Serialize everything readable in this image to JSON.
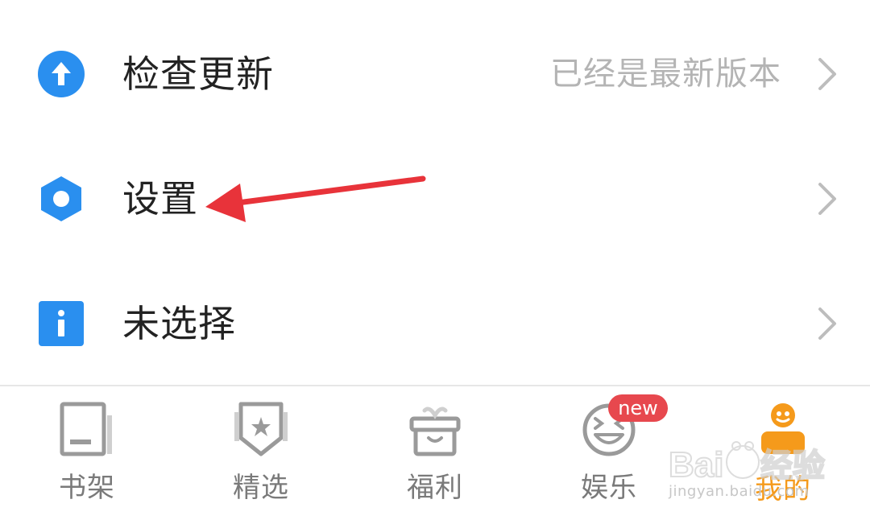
{
  "settings": {
    "items": [
      {
        "label": "检查更新",
        "value": "已经是最新版本",
        "icon": "upload-arrow-icon",
        "icon_color": "#2a8fef"
      },
      {
        "label": "设置",
        "value": "",
        "icon": "gear-hexagon-icon",
        "icon_color": "#2a8fef"
      },
      {
        "label": "未选择",
        "value": "",
        "icon": "info-icon",
        "icon_color": "#2a8fef"
      }
    ]
  },
  "annotation": {
    "arrow_color": "#e8333a"
  },
  "tabbar": {
    "tabs": [
      {
        "label": "书架",
        "icon": "bookshelf-icon",
        "active": false
      },
      {
        "label": "精选",
        "icon": "star-badge-icon",
        "active": false
      },
      {
        "label": "福利",
        "icon": "gift-icon",
        "active": false
      },
      {
        "label": "娱乐",
        "icon": "laughing-face-icon",
        "active": false,
        "badge": "new"
      },
      {
        "label": "我的",
        "icon": "profile-icon",
        "active": true
      }
    ],
    "active_color": "#f59a1b",
    "inactive_color": "#7a7a7a",
    "badge_color": "#e7484e"
  },
  "watermark": {
    "logo": "Baidu经验",
    "url": "jingyan.baidu.com"
  }
}
